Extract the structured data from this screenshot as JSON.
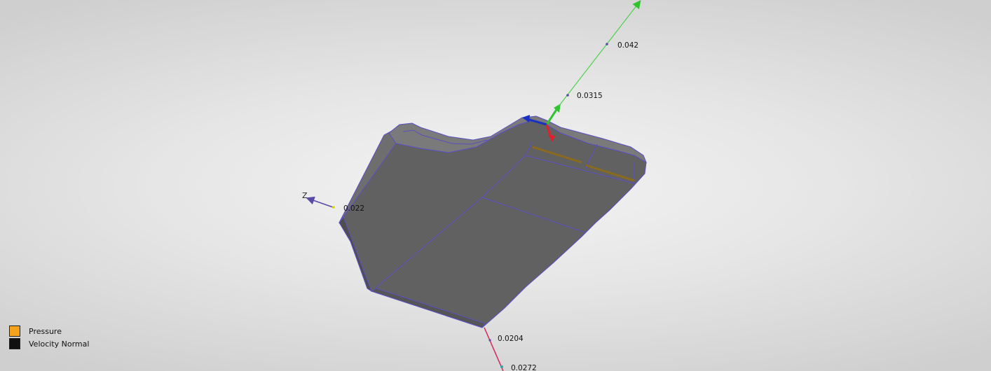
{
  "dimension_labels": {
    "top_far": "0.042",
    "top_near": "0.0315",
    "left": "0.022",
    "bottom_near": "0.0204",
    "bottom_far": "0.0272"
  },
  "axes": {
    "z_letter": "Z",
    "colors": {
      "x_axis": "#e0202a",
      "y_axis": "#2fc42f",
      "z_axis": "#1a2fc4",
      "dimension_y": "#4fd14f",
      "dimension_z": "#5a4aa8",
      "dimension_x": "#d4285a"
    }
  },
  "model": {
    "face_color": "#636363",
    "edge_color": "#5a4fc2",
    "highlight_edge_color": "#8a6a1e"
  },
  "legend": {
    "items": [
      {
        "label": "Pressure",
        "color": "#f5a31a"
      },
      {
        "label": "Velocity Normal",
        "color": "#111111"
      }
    ]
  },
  "background": {
    "center_color": "#f3f3f3",
    "edge_color": "#cfcfcf"
  }
}
